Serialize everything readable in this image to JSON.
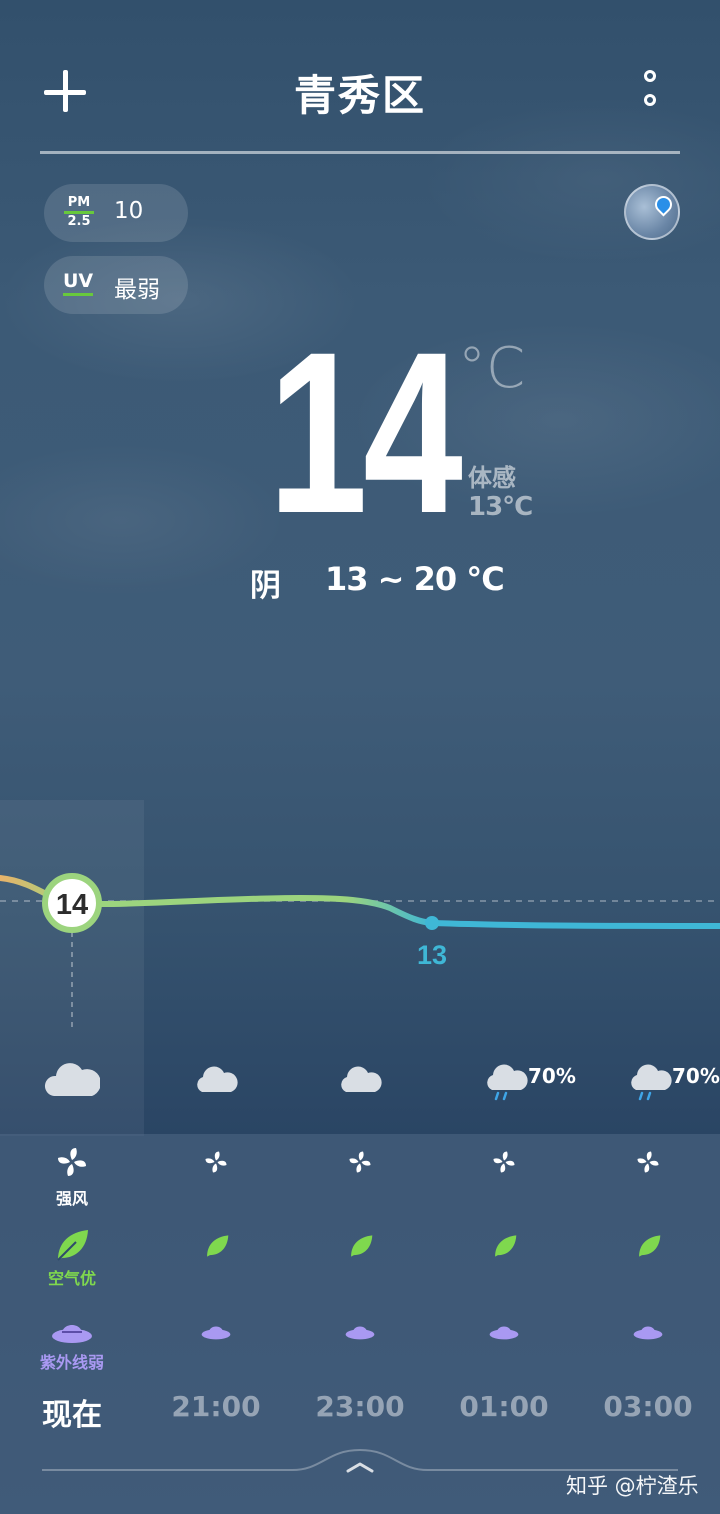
{
  "header": {
    "city": "青秀区",
    "add_icon": "plus-icon",
    "more_icon": "more-vertical-icon"
  },
  "badges": {
    "pm_label_top": "PM",
    "pm_label_bottom": "2.5",
    "pm_value": "10",
    "uv_label": "UV",
    "uv_value": "最弱",
    "accent": "#68c93c"
  },
  "map_icon": "map-pin-icon",
  "current": {
    "temp": "14",
    "unit": "°C",
    "feels_label": "体感",
    "feels_value": "13°C",
    "condition": "阴",
    "range": "13 ~ 20 °C"
  },
  "chart_data": {
    "type": "line",
    "x": [
      "现在",
      "21:00",
      "23:00",
      "01:00",
      "03:00"
    ],
    "values": [
      14,
      14,
      14,
      13,
      13
    ],
    "labels_shown": {
      "high": "14",
      "low": "13"
    },
    "colors": {
      "warm": "#e9b36a",
      "mild": "#9cd47e",
      "cool": "#3fb7d6"
    }
  },
  "hourly": [
    {
      "time": "现在",
      "weather": "cloud-icon",
      "precip": "",
      "wind_label": "强风",
      "air_label": "空气优",
      "uv_label": "紫外线弱"
    },
    {
      "time": "21:00",
      "weather": "cloud-icon",
      "precip": ""
    },
    {
      "time": "23:00",
      "weather": "cloud-icon",
      "precip": ""
    },
    {
      "time": "01:00",
      "weather": "rain-icon",
      "precip": "70%"
    },
    {
      "time": "03:00",
      "weather": "rain-icon",
      "precip": "70%"
    }
  ],
  "label_colors": {
    "wind": "#ffffff",
    "air": "#7fd84e",
    "uv": "#a999f2"
  },
  "watermark": "知乎 @柠渣乐"
}
